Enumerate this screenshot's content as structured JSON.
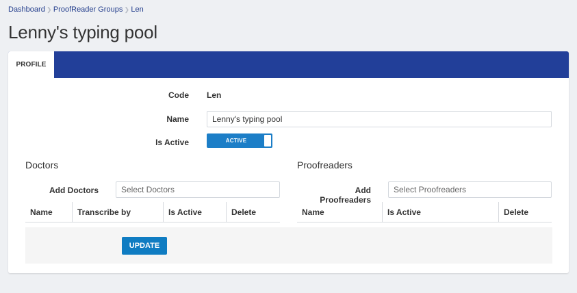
{
  "breadcrumb": {
    "items": [
      "Dashboard",
      "ProofReader Groups",
      "Len"
    ]
  },
  "page": {
    "title": "Lenny's typing pool"
  },
  "tabs": [
    {
      "label": "PROFILE",
      "active": true
    }
  ],
  "colors": {
    "tabbar": "#223f99",
    "accent": "#0f7cc2",
    "link": "#1f3a8a"
  },
  "icons": {
    "breadcrumb_separator": "chevron-right-icon"
  },
  "form": {
    "code_label": "Code",
    "code_value": "Len",
    "name_label": "Name",
    "name_value": "Lenny's typing pool",
    "active_label": "Is Active",
    "active_toggle_text": "ACTIVE",
    "active_state": true
  },
  "doctors": {
    "title": "Doctors",
    "add_label": "Add Doctors",
    "placeholder": "Select Doctors",
    "columns": [
      "Name",
      "Transcribe by",
      "Is Active",
      "Delete"
    ]
  },
  "proofreaders": {
    "title": "Proofreaders",
    "add_label": "Add Proofreaders",
    "placeholder": "Select Proofreaders",
    "columns": [
      "Name",
      "Is Active",
      "Delete"
    ]
  },
  "actions": {
    "update_label": "UPDATE"
  }
}
